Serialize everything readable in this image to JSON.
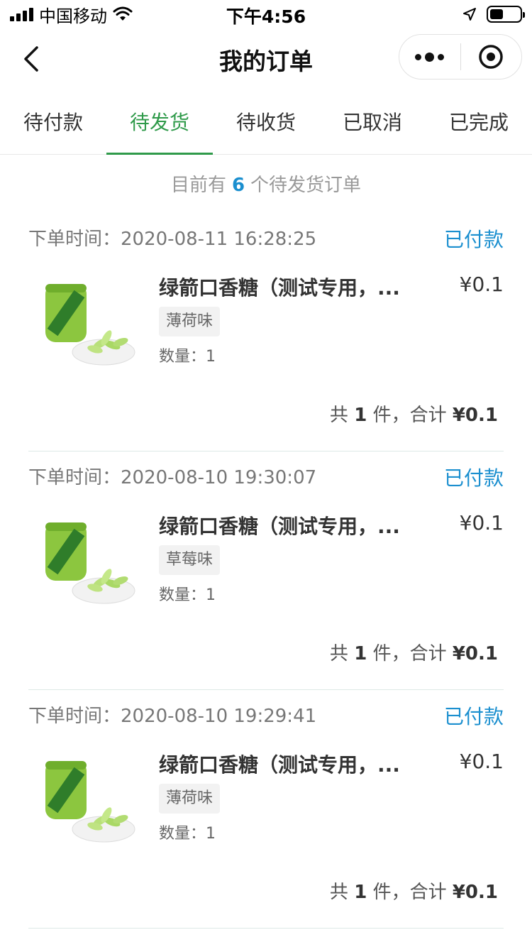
{
  "status_bar": {
    "carrier": "中国移动",
    "time": "下午4:56",
    "battery_level": 0.45
  },
  "nav": {
    "title": "我的订单"
  },
  "tabs": [
    {
      "label": "待付款",
      "active": false
    },
    {
      "label": "待发货",
      "active": true
    },
    {
      "label": "待收货",
      "active": false
    },
    {
      "label": "已取消",
      "active": false
    },
    {
      "label": "已完成",
      "active": false
    }
  ],
  "summary": {
    "prefix": "目前有",
    "count": "6",
    "suffix": "个待发货订单"
  },
  "orders": [
    {
      "time_label": "下单时间：",
      "time": "2020-08-11 16:28:25",
      "status": "已付款",
      "product_name": "绿箭口香糖（测试专用，...",
      "price": "¥0.1",
      "variant": "薄荷味",
      "qty_label": "数量：",
      "qty": "1",
      "total_prefix": "共",
      "total_count": "1",
      "total_middle": "件，合计",
      "total_amount": "¥0.1"
    },
    {
      "time_label": "下单时间：",
      "time": "2020-08-10 19:30:07",
      "status": "已付款",
      "product_name": "绿箭口香糖（测试专用，...",
      "price": "¥0.1",
      "variant": "草莓味",
      "qty_label": "数量：",
      "qty": "1",
      "total_prefix": "共",
      "total_count": "1",
      "total_middle": "件，合计",
      "total_amount": "¥0.1"
    },
    {
      "time_label": "下单时间：",
      "time": "2020-08-10 19:29:41",
      "status": "已付款",
      "product_name": "绿箭口香糖（测试专用，...",
      "price": "¥0.1",
      "variant": "薄荷味",
      "qty_label": "数量：",
      "qty": "1",
      "total_prefix": "共",
      "total_count": "1",
      "total_middle": "件，合计",
      "total_amount": "¥0.1"
    }
  ],
  "colors": {
    "accent_green": "#2f9a4a",
    "status_blue": "#1b8fcf"
  },
  "icons": [
    "signal-icon",
    "wifi-icon",
    "location-arrow-icon",
    "battery-icon",
    "back-arrow-icon",
    "more-icon",
    "close-target-icon",
    "gum-product-thumbnail"
  ]
}
